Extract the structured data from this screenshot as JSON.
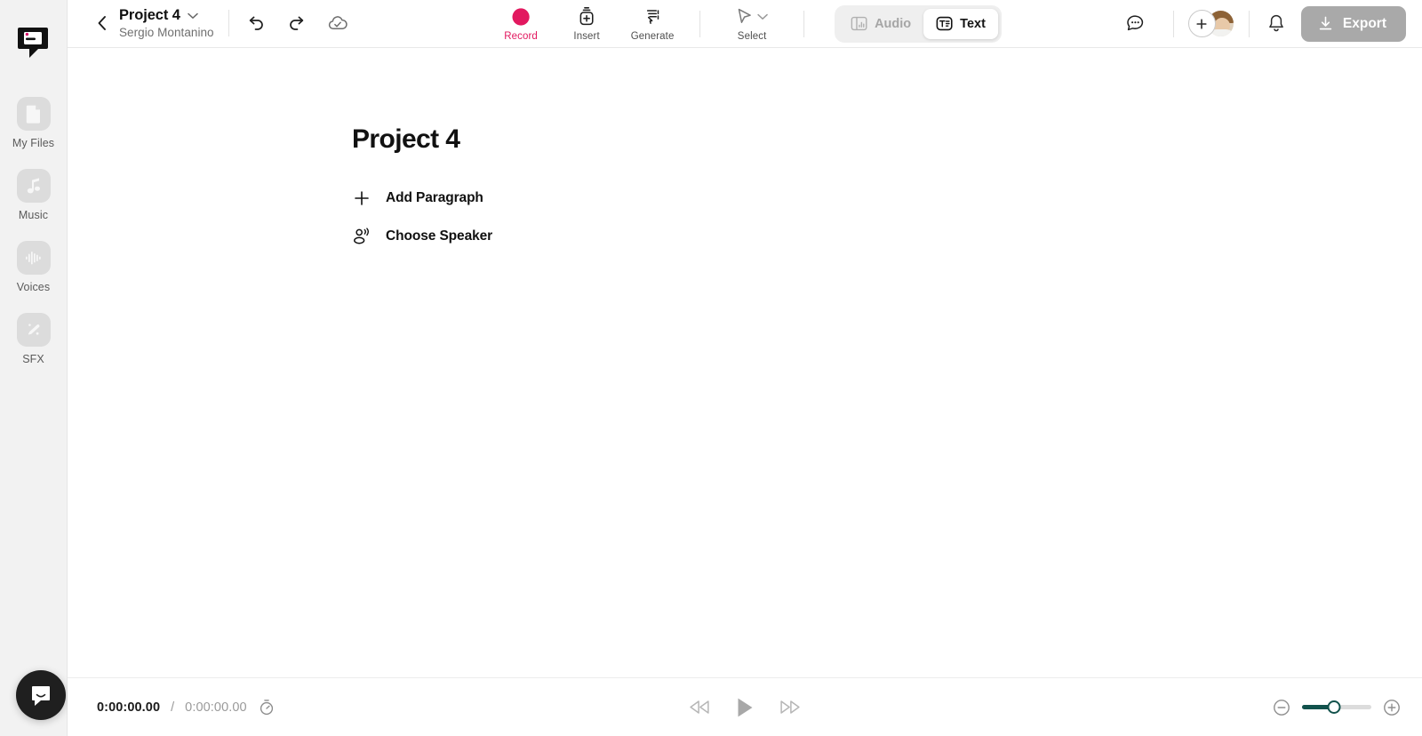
{
  "app": {
    "name": "Descript",
    "logo_icon": "descript-speech-bubble-logo",
    "accent_record": "#e2185f",
    "accent_slider": "#12524c",
    "export_bg": "#a9a9a9"
  },
  "sidebar": {
    "items": [
      {
        "label": "My Files",
        "icon": "document-page-icon"
      },
      {
        "label": "Music",
        "icon": "music-note-icon"
      },
      {
        "label": "Voices",
        "icon": "waveform-icon"
      },
      {
        "label": "SFX",
        "icon": "magic-wand-sparkle-icon"
      }
    ],
    "support_widget": {
      "icon": "intercom-chat-bubble-icon"
    }
  },
  "topbar": {
    "back_icon": "chevron-left-icon",
    "project_title": "Project 4",
    "project_dropdown_icon": "chevron-down-icon",
    "project_owner": "Sergio Montanino",
    "history": [
      {
        "label": "Undo",
        "icon": "undo-arrow-icon"
      },
      {
        "label": "Redo",
        "icon": "redo-arrow-icon"
      },
      {
        "label": "Saved to cloud",
        "icon": "cloud-check-icon"
      }
    ],
    "tools": [
      {
        "label": "Record",
        "icon": "record-circle-icon",
        "active": true
      },
      {
        "label": "Insert",
        "icon": "insert-plus-icon",
        "active": false
      },
      {
        "label": "Generate",
        "icon": "generate-sparkle-icon",
        "active": false
      },
      {
        "label": "Select",
        "icon": "cursor-arrow-icon",
        "active": false
      }
    ],
    "view_modes": [
      {
        "label": "Audio",
        "icon": "audio-panels-icon",
        "active": false
      },
      {
        "label": "Text",
        "icon": "text-box-icon",
        "active": true
      }
    ],
    "comments_icon": "comment-bubble-icon",
    "add_collaborator_icon": "plus-circle-icon",
    "avatar_icon": "user-avatar",
    "notifications_icon": "bell-icon",
    "export": {
      "label": "Export",
      "icon": "download-arrow-icon"
    }
  },
  "document": {
    "title": "Project 4",
    "actions": [
      {
        "label": "Add Paragraph",
        "icon": "plus-icon"
      },
      {
        "label": "Choose Speaker",
        "icon": "speaker-person-icon"
      }
    ]
  },
  "transport": {
    "current_time": "0:00:00.00",
    "separator": "/",
    "total_time": "0:00:00.00",
    "timer_icon": "stopwatch-icon",
    "controls": [
      {
        "label": "Rewind",
        "icon": "rewind-icon"
      },
      {
        "label": "Play",
        "icon": "play-icon"
      },
      {
        "label": "Fast forward",
        "icon": "fast-forward-icon"
      }
    ],
    "zoom": {
      "out_icon": "minus-circle-icon",
      "in_icon": "plus-circle-icon",
      "value": 46
    }
  }
}
